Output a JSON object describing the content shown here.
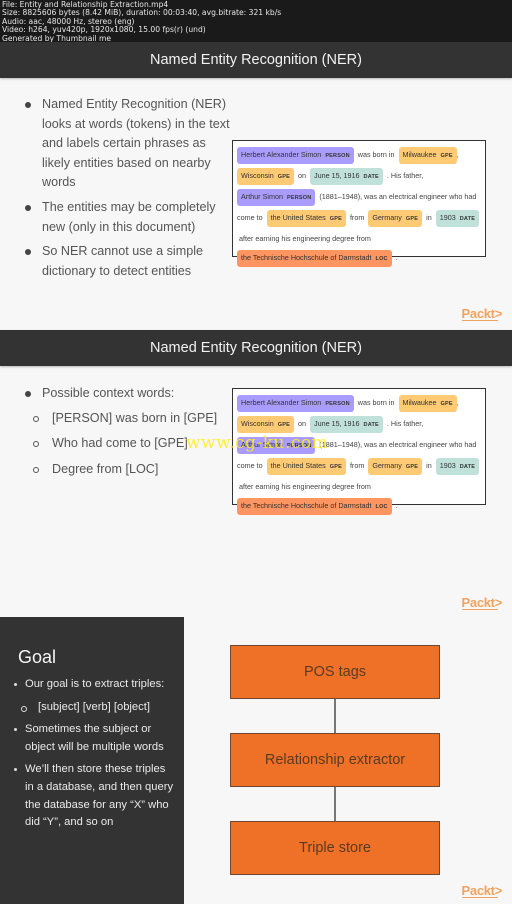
{
  "file_info": {
    "lines": [
      "File: Entity and Relationship Extraction.mp4",
      "Size: 8825606 bytes (8.42 MiB), duration: 00:03:40, avg.bitrate: 321 kb/s",
      "Audio: aac, 48000 Hz, stereo (eng)",
      "Video: h264, yuv420p, 1920x1080, 15.00 fps(r) (und)",
      "Generated by Thumbnail me"
    ]
  },
  "ner_example": {
    "tokens": [
      {
        "text": "Herbert Alexander Simon",
        "label": "PERSON"
      },
      {
        "text": "was born in"
      },
      {
        "text": "Milwaukee",
        "label": "GPE"
      },
      {
        "text": ","
      },
      {
        "text": "Wisconsin",
        "label": "GPE"
      },
      {
        "text": "on"
      },
      {
        "text": "June 15, 1916",
        "label": "DATE"
      },
      {
        "text": ". His father,"
      },
      {
        "text": "Arthur Simon",
        "label": "PERSON"
      },
      {
        "text": "(1881–1948), was an electrical engineer who had come to"
      },
      {
        "text": "the United States",
        "label": "GPE"
      },
      {
        "text": "from"
      },
      {
        "text": "Germany",
        "label": "GPE"
      },
      {
        "text": "in"
      },
      {
        "text": "1903",
        "label": "DATE"
      },
      {
        "text": "after earning his engineering degree from"
      },
      {
        "text": "the Technische Hochschule of Darmstadt",
        "label": "LOC"
      },
      {
        "text": "."
      }
    ],
    "colors": {
      "PERSON": "#aa9cfc",
      "GPE": "#feca74",
      "DATE": "#bfe1d9",
      "LOC": "#ff9561"
    }
  },
  "slides": [
    {
      "title": "Named Entity Recognition (NER)",
      "bullets": [
        "Named Entity Recognition (NER) looks at words (tokens) in the text and labels certain phrases as likely entities based on nearby words",
        "The entities may be completely new (only in this document)",
        "So NER cannot use a simple dictionary to detect entities"
      ],
      "logo": "Packt>"
    },
    {
      "title": "Named Entity Recognition (NER)",
      "bullets": [
        "Possible context words:"
      ],
      "sub_bullets": [
        "[PERSON] was born in [GPE]",
        "Who had come to [GPE]",
        "Degree from [LOC]"
      ],
      "watermark": "www.cg-ku.com",
      "logo": "Packt>"
    },
    {
      "title": "Goal",
      "bullets": [
        "Our goal is to extract triples:",
        "Sometimes the subject or object will be multiple words",
        "We’ll then store these triples in a database, and then query the database for any “X” who did “Y”, and so on"
      ],
      "sub_bullets": [
        "[subject] [verb] [object]"
      ],
      "flow": [
        "POS tags",
        "Relationship extractor",
        "Triple store"
      ],
      "flow_color": "#ef7127",
      "logo": "Packt>"
    }
  ]
}
